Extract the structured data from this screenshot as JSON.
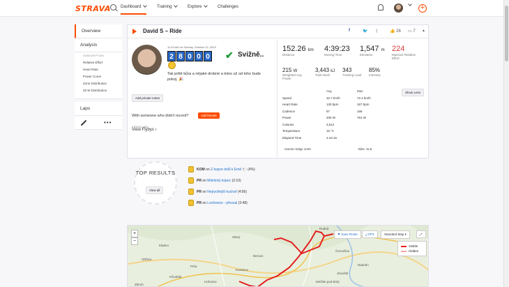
{
  "brand": {
    "logo": "STRAVA",
    "accent": "#fc4c02"
  },
  "nav": {
    "items": [
      "Dashboard",
      "Training",
      "Explore",
      "Challenges"
    ]
  },
  "sidebar": {
    "overview": "Overview",
    "analysis": "Analysis",
    "subscription_caption": "SUBSCRIPTION",
    "sub_items": [
      "Relative Effort",
      "Heart Rate",
      "Power Curve",
      "Zone Distribution",
      "25 W Distribution"
    ],
    "laps": "Laps"
  },
  "activity": {
    "title": "David S – Ride",
    "datetime": "11:04 AM on Sunday, October 22, 2023",
    "name_digits": [
      "2",
      "8",
      "0",
      "0",
      "0"
    ],
    "name_suffix": "Svižně..",
    "description": "Tak ještě bůra a nějaké drobné a letos už od toho bude pokoj. 🎉",
    "kudos": "26",
    "comments": "7",
    "add_notes": "Add private notes",
    "with_someone": "With someone who didn't record?",
    "add_friends": "Add friends",
    "flyby_caption": "STRAVA LABS",
    "view_flybys": "View Flybys"
  },
  "stats": {
    "distance": {
      "value": "152.26",
      "unit": "km",
      "label": "Distance"
    },
    "moving_time": {
      "value": "4:39:23",
      "label": "Moving Time"
    },
    "elevation": {
      "value": "1,547",
      "unit": "m",
      "label": "Elevation"
    },
    "relative_effort": {
      "value": "224",
      "label": "Massive Relative Effort",
      "color": "#d93a3a"
    },
    "weighted_power": {
      "value": "215",
      "unit": "W",
      "label": "Weighted Avg Power"
    },
    "total_work": {
      "value": "3,443",
      "unit": "kJ",
      "label": "Total Work"
    },
    "training_load": {
      "value": "343",
      "label": "Training Load"
    },
    "intensity": {
      "value": "85%",
      "label": "Intensity"
    },
    "show_less": "Show Less",
    "table": {
      "headers": [
        "",
        "Avg",
        "Max"
      ],
      "rows": [
        [
          "Speed",
          "32.7 km/h",
          "72.4 km/h"
        ],
        [
          "Heart Rate",
          "130 bpm",
          "167 bpm"
        ],
        [
          "Cadence",
          "87",
          "166"
        ],
        [
          "Power",
          "205 W",
          "791 W"
        ],
        [
          "Calories",
          "3,512",
          ""
        ],
        [
          "Temperature",
          "15 °C",
          ""
        ],
        [
          "Elapsed Time",
          "4:44:16",
          ""
        ]
      ]
    },
    "device": "Garmin Edge 1040",
    "bike": "Bike: SL8"
  },
  "top_results": {
    "title": "TOP RESULTS",
    "view_all": "View all",
    "items": [
      {
        "type": "KOM",
        "prefix": "on",
        "segment": "Z kopce dolů k Emě 🐑",
        "rank": "(4%)"
      },
      {
        "type": "PR",
        "prefix": "on",
        "segment": "Milotický kopec",
        "rank": "(2:10)"
      },
      {
        "type": "PR",
        "prefix": "on",
        "segment": "Nejrychlejší kuchař",
        "rank": "(4:56)"
      },
      {
        "type": "PR",
        "prefix": "on",
        "segment": "Lochovice - převzal",
        "rank": "(3:48)"
      }
    ]
  },
  "map": {
    "save_route": "Save Route",
    "gpx": "GPX",
    "map_type": "Standard Map",
    "legend_visible": "Visible",
    "legend_hidden": "Hidden",
    "places": [
      "Rudná",
      "Kladno",
      "Ohřtice",
      "Prha",
      "Slaný",
      "Křivoklát",
      "Zbiroh",
      "Hořovice",
      "Beroun",
      "Komárov",
      "Mníšek pod Brdy",
      "Černošice",
      "Radotín",
      "Jíloviště"
    ]
  }
}
